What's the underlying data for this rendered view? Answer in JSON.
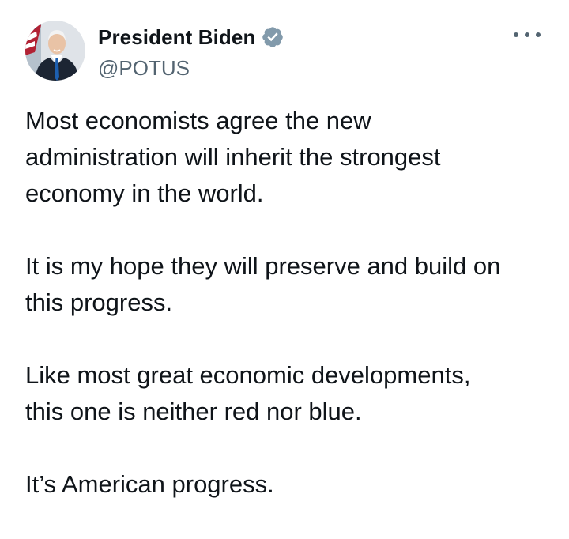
{
  "author": {
    "display_name": "President Biden",
    "handle": "@POTUS",
    "verified_icon": "verified-badge-icon",
    "avatar_icon": "avatar"
  },
  "menu": {
    "icon": "more-options-icon"
  },
  "tweet": {
    "paragraphs": [
      "Most economists agree the new\nadministration will inherit the strongest\neconomy in the world.",
      "It is my hope they will preserve and build on\nthis progress.",
      "Like most great economic developments,\nthis one is neither red nor blue.",
      "It’s American progress."
    ]
  },
  "colors": {
    "text": "#0f1419",
    "secondary": "#536471",
    "verified_badge": "#829aab",
    "background": "#ffffff"
  }
}
